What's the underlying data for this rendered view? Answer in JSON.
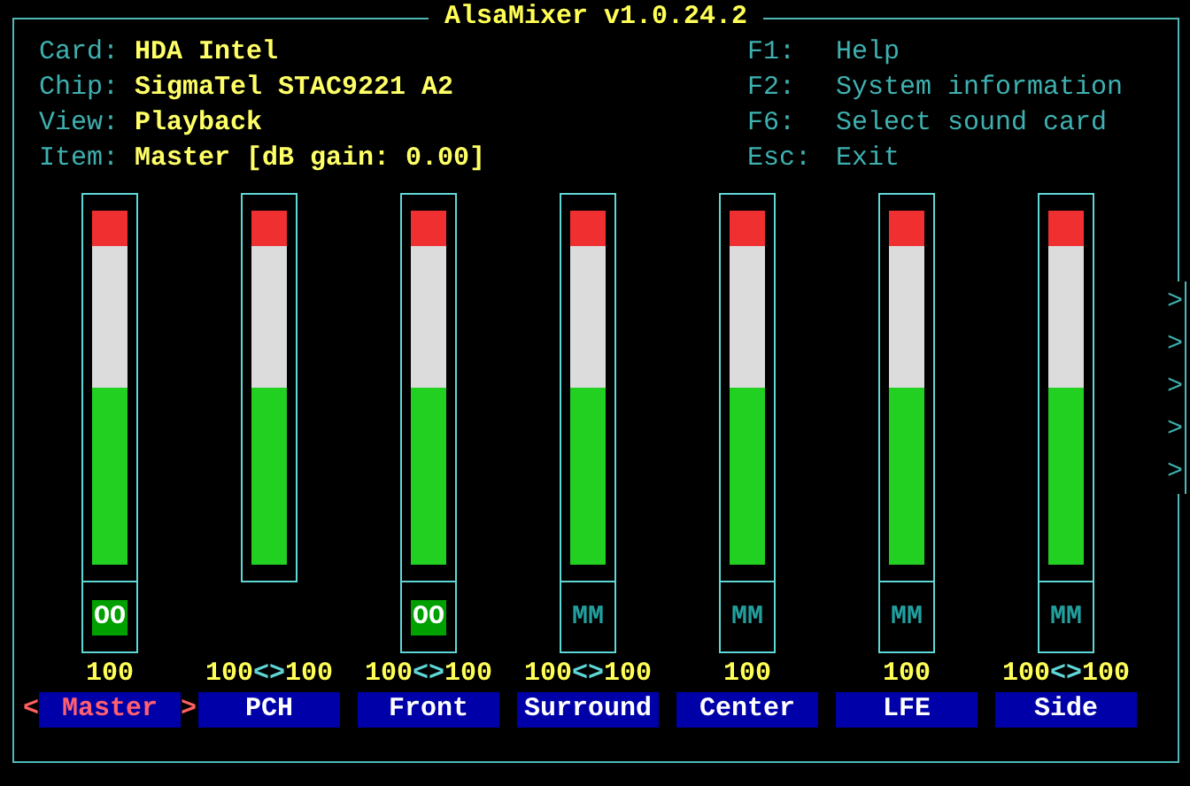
{
  "window": {
    "title": "AlsaMixer v1.0.24.2"
  },
  "info": [
    {
      "label": "Card:",
      "value": "HDA Intel"
    },
    {
      "label": "Chip:",
      "value": "SigmaTel STAC9221 A2"
    },
    {
      "label": "View:",
      "value": "Playback"
    },
    {
      "label": "Item:",
      "value": "Master [dB gain: 0.00]"
    }
  ],
  "keys": [
    {
      "key": "F1:",
      "action": "Help"
    },
    {
      "key": "F2:",
      "action": "System information"
    },
    {
      "key": "F6:",
      "action": "Select sound card"
    },
    {
      "key": "Esc:",
      "action": "Exit"
    }
  ],
  "channels": [
    {
      "name": "Master",
      "selected": true,
      "level": 1,
      "kind": "mono",
      "values": [
        "100"
      ],
      "mute": {
        "text": "OO",
        "muted": false
      },
      "prev": "<",
      "next": ">"
    },
    {
      "name": "PCH",
      "selected": false,
      "level": 1,
      "kind": "stereo",
      "values": [
        "100",
        "<>",
        "100"
      ]
    },
    {
      "name": "Front",
      "selected": false,
      "level": 1,
      "kind": "stereo",
      "values": [
        "100",
        "<>",
        "100"
      ],
      "mute": {
        "text": "OO",
        "muted": false
      }
    },
    {
      "name": "Surround",
      "selected": false,
      "level": 1,
      "kind": "stereo",
      "values": [
        "100",
        "<>",
        "100"
      ],
      "mute": {
        "text": "MM",
        "muted": true
      }
    },
    {
      "name": "Center",
      "selected": false,
      "level": 1,
      "kind": "mono",
      "values": [
        "100"
      ],
      "mute": {
        "text": "MM",
        "muted": true
      }
    },
    {
      "name": "LFE",
      "selected": false,
      "level": 1,
      "kind": "mono",
      "values": [
        "100"
      ],
      "mute": {
        "text": "MM",
        "muted": true
      }
    },
    {
      "name": "Side",
      "selected": false,
      "level": 1,
      "kind": "stereo",
      "values": [
        "100",
        "<>",
        "100"
      ],
      "mute": {
        "text": "MM",
        "muted": true
      }
    }
  ],
  "scroll_indicator": [
    ">",
    ">",
    ">",
    ">",
    ">"
  ]
}
